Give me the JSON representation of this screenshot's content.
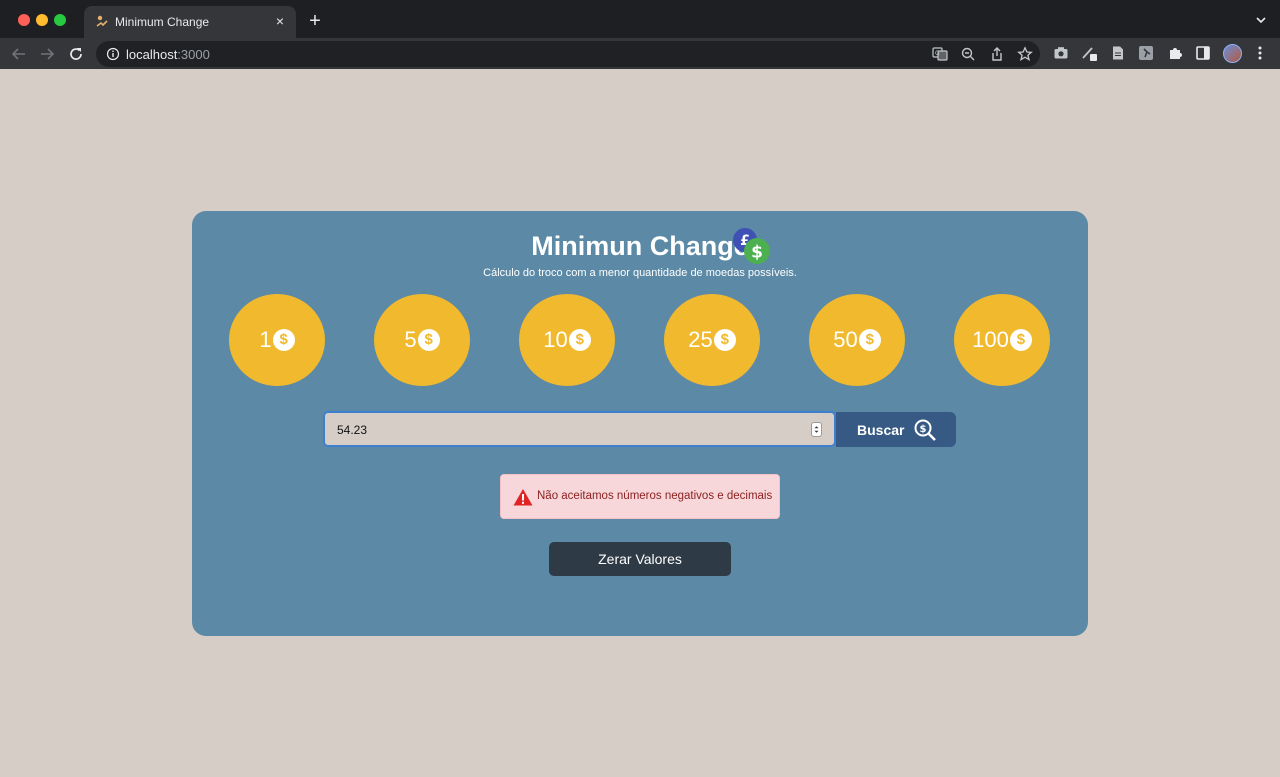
{
  "browser": {
    "tab_title": "Minimum Change",
    "tab_close": "×",
    "new_tab": "+",
    "url_host": "localhost",
    "url_port": ":3000"
  },
  "app": {
    "title": "Minimun Change",
    "subtitle": "Cálculo do troco com a menor quantidade de moedas possíveis.",
    "coins": [
      "1",
      "5",
      "10",
      "25",
      "50",
      "100"
    ],
    "coin_symbol": "$",
    "logo_symbols": [
      "£",
      "$"
    ],
    "input": {
      "value": "54.23"
    },
    "search_label": "Buscar",
    "error_message": "Não aceitamos números negativos e decimais",
    "reset_label": "Zerar Valores"
  },
  "colors": {
    "background": "#d5cdc6",
    "card": "#5b89a6",
    "coin": "#f0b92e",
    "search_button": "#365a83",
    "reset_button": "#2e3a46",
    "alert_bg": "#f8d7da",
    "alert_text": "#8a1f1f"
  },
  "icons": [
    "minimum-change-logo-icon",
    "dollar-coin-icon",
    "search-dollar-icon",
    "warning-icon"
  ]
}
